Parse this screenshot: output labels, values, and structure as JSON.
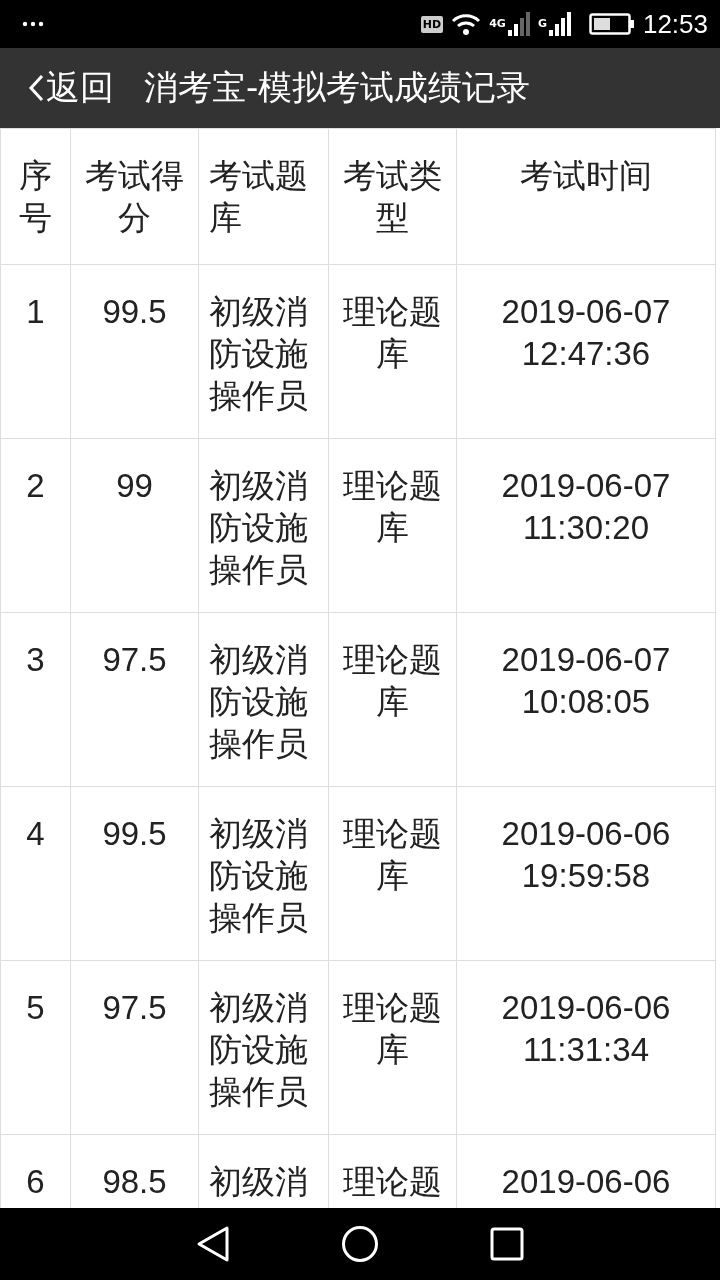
{
  "status_bar": {
    "hd_badge": "HD",
    "network_1": "4G",
    "network_2": "G",
    "time": "12:53"
  },
  "header": {
    "back": "返回",
    "title": "消考宝-模拟考试成绩记录"
  },
  "table": {
    "columns": [
      "序号",
      "考试得分",
      "考试题库",
      "考试类型",
      "考试时间"
    ],
    "rows": [
      {
        "index": "1",
        "score": "99.5",
        "bank": "初级消防设施操作员",
        "type": "理论题库",
        "time": "2019-06-07 12:47:36"
      },
      {
        "index": "2",
        "score": "99",
        "bank": "初级消防设施操作员",
        "type": "理论题库",
        "time": "2019-06-07 11:30:20"
      },
      {
        "index": "3",
        "score": "97.5",
        "bank": "初级消防设施操作员",
        "type": "理论题库",
        "time": "2019-06-07 10:08:05"
      },
      {
        "index": "4",
        "score": "99.5",
        "bank": "初级消防设施操作员",
        "type": "理论题库",
        "time": "2019-06-06 19:59:58"
      },
      {
        "index": "5",
        "score": "97.5",
        "bank": "初级消防设施操作员",
        "type": "理论题库",
        "time": "2019-06-06 11:31:34"
      },
      {
        "index": "6",
        "score": "98.5",
        "bank": "初级消",
        "type": "理论题",
        "time": "2019-06-06"
      }
    ]
  }
}
